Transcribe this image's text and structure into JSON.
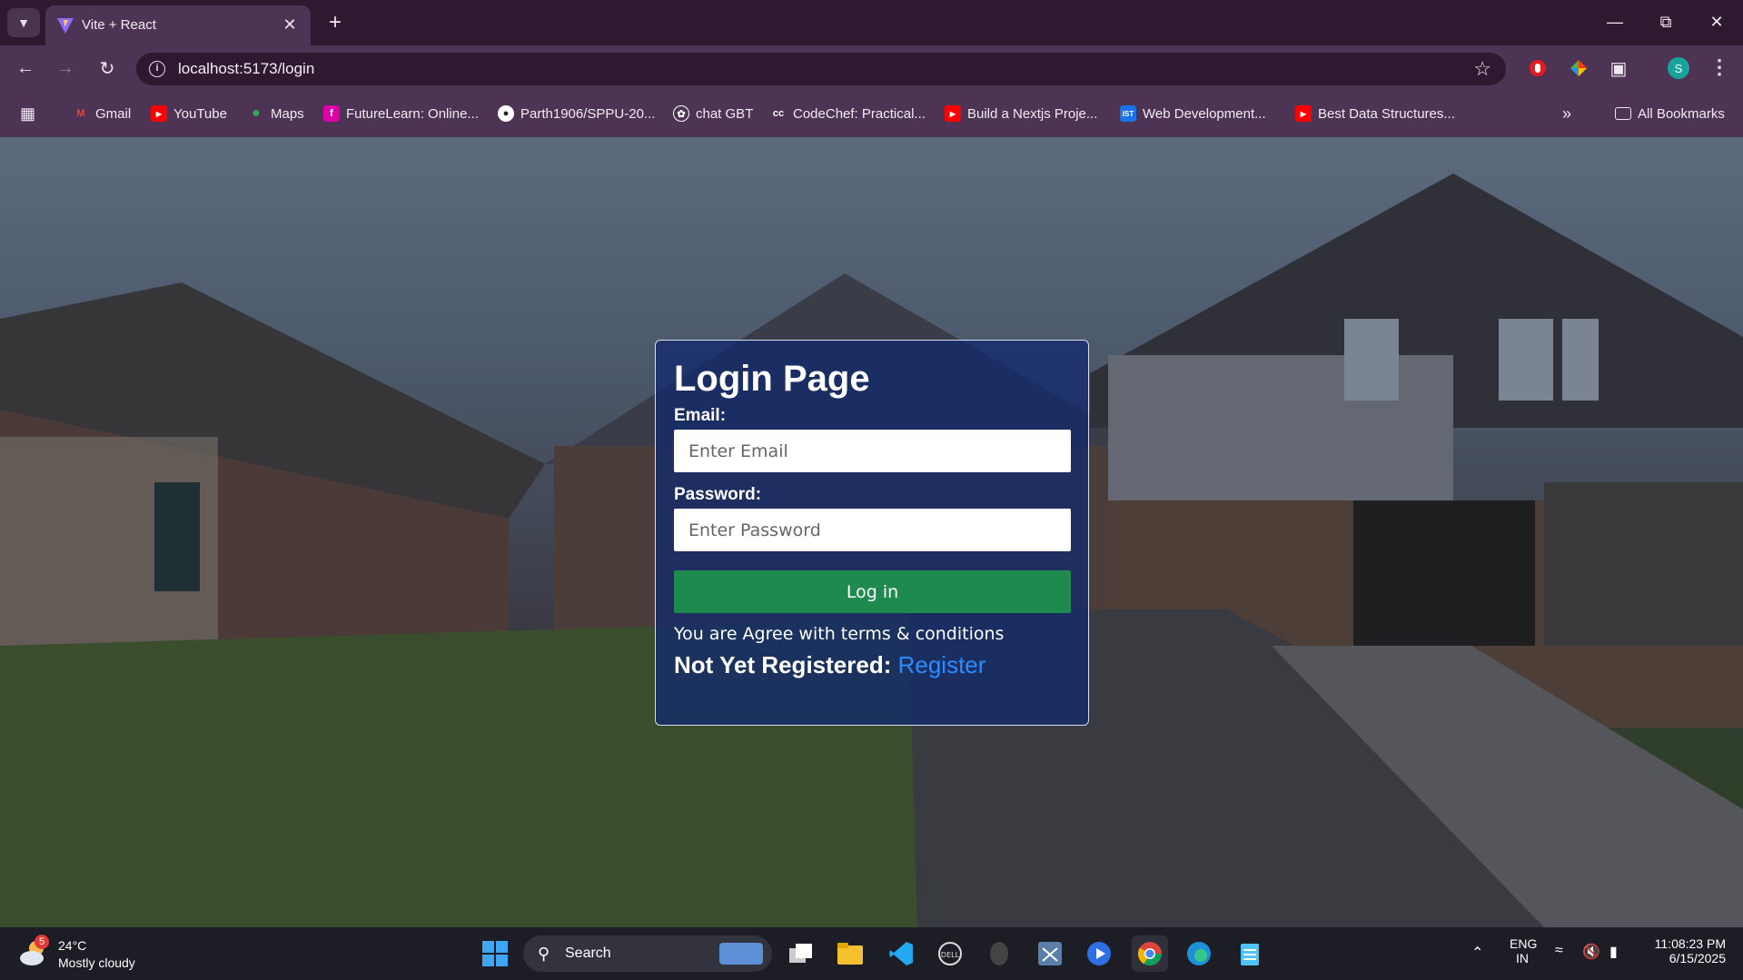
{
  "browser": {
    "tab_title": "Vite + React",
    "url": "localhost:5173/login",
    "profile_initial": "S",
    "bookmarks": [
      {
        "label": "Gmail",
        "icon": "gmail-icon"
      },
      {
        "label": "YouTube",
        "icon": "youtube-icon"
      },
      {
        "label": "Maps",
        "icon": "maps-icon"
      },
      {
        "label": "FutureLearn: Online...",
        "icon": "futurelearn-icon"
      },
      {
        "label": "Parth1906/SPPU-20...",
        "icon": "github-icon"
      },
      {
        "label": "chat GBT",
        "icon": "openai-icon"
      },
      {
        "label": "CodeChef: Practical...",
        "icon": "codechef-icon"
      },
      {
        "label": "Build a Nextjs Proje...",
        "icon": "youtube-icon"
      },
      {
        "label": "Web Development...",
        "icon": "ist-icon"
      },
      {
        "label": "Best Data Structures...",
        "icon": "youtube-icon"
      }
    ],
    "all_bookmarks": "All Bookmarks"
  },
  "login": {
    "title": "Login Page",
    "email_label": "Email:",
    "email_placeholder": "Enter Email",
    "password_label": "Password:",
    "password_placeholder": "Enter Password",
    "submit_label": "Log in",
    "terms_text": "You are Agree with terms & conditions",
    "register_prompt": "Not Yet Registered:",
    "register_link": "Register"
  },
  "taskbar": {
    "weather_badge": "5",
    "temperature": "24°C",
    "condition": "Mostly cloudy",
    "search_label": "Search",
    "language_line1": "ENG",
    "language_line2": "IN",
    "time": "11:08:23 PM",
    "date": "6/15/2025"
  },
  "colors": {
    "accent_green": "#1f8a4e",
    "card_blue": "#122a6c",
    "link_blue": "#2b8bff",
    "chrome_purple": "#4d3454"
  }
}
